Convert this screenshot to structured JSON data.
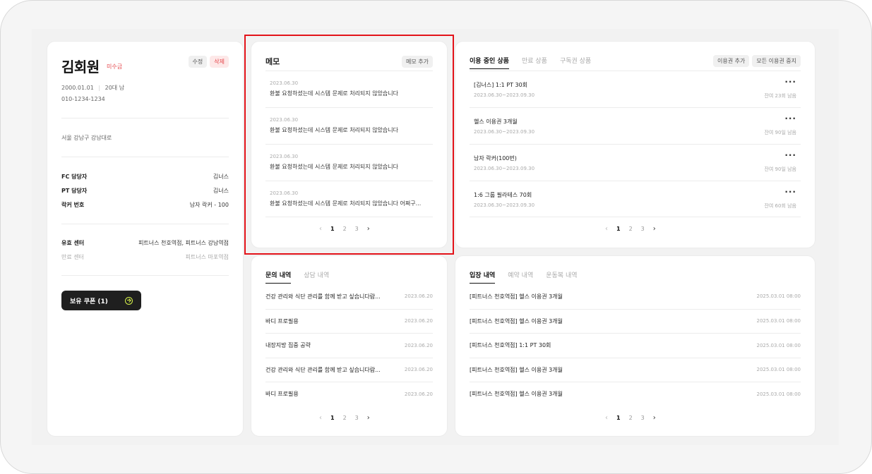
{
  "profile": {
    "name": "김회원",
    "arrears_badge": "미수금",
    "edit_label": "수정",
    "delete_label": "삭제",
    "birth": "2000.01.01",
    "age_gender": "20대 남",
    "phone": "010-1234-1234",
    "address": "서울 강남구 강남대로",
    "staff": [
      {
        "key": "FC 담당자",
        "value": "김너스"
      },
      {
        "key": "PT 담당자",
        "value": "김너스"
      },
      {
        "key": "락커 번호",
        "value": "남자 락커 - 100"
      }
    ],
    "centers": [
      {
        "key": "유효 센터",
        "value": "피트너스 천호역점, 피트너스 강남역점"
      },
      {
        "key": "만료 센터",
        "value": "피트너스 마포역점"
      }
    ],
    "coupon_label": "보유 쿠폰 (1)"
  },
  "memo": {
    "title": "메모",
    "add_label": "메모 추가",
    "items": [
      {
        "date": "2023.06.30",
        "text": "환불 요청하셨는데 시스템 문제로 처리되지 않았습니다"
      },
      {
        "date": "2023.06.30",
        "text": "환불 요청하셨는데 시스템 문제로 처리되지 않았습니다"
      },
      {
        "date": "2023.06.30",
        "text": "환불 요청하셨는데 시스템 문제로 처리되지 않았습니다"
      },
      {
        "date": "2023.06.30",
        "text": "환불 요청하셨는데 시스템 문제로 처리되지 않았습니다 어쩌구..."
      }
    ],
    "pages": [
      "1",
      "2",
      "3"
    ]
  },
  "products": {
    "tabs": [
      "이용 중인 상품",
      "만료 상품",
      "구독권 상품"
    ],
    "add_label": "이용권 추가",
    "stop_all_label": "모든 이용권 중지",
    "items": [
      {
        "name": "[김너스] 1:1 PT 30회",
        "period": "2023.06.30~2023.09.30",
        "remain": "잔여 23회 남음"
      },
      {
        "name": "헬스 이용권 3개월",
        "period": "2023.06.30~2023.09.30",
        "remain": "잔여 90일 남음"
      },
      {
        "name": "남자 락커(100번)",
        "period": "2023.06.30~2023.09.30",
        "remain": "잔여 90일 남음"
      },
      {
        "name": "1:6 그룹 필라테스 70회",
        "period": "2023.06.30~2023.09.30",
        "remain": "잔여 60회 남음"
      }
    ],
    "more_glyph": "···",
    "pages": [
      "1",
      "2",
      "3"
    ]
  },
  "inquiries": {
    "tabs": [
      "문의 내역",
      "상담 내역"
    ],
    "items": [
      {
        "title": "건강 관리와 식단 관리를 함께 받고 싶습니다람...",
        "date": "2023.06.20"
      },
      {
        "title": "바디 프로필용",
        "date": "2023.06.20"
      },
      {
        "title": "내장지방 집중 공략",
        "date": "2023.06.20"
      },
      {
        "title": "건강 관리와 식단 관리를 함께 받고 싶습니다람...",
        "date": "2023.06.20"
      },
      {
        "title": "바디 프로필용",
        "date": "2023.06.20"
      }
    ],
    "pages": [
      "1",
      "2",
      "3"
    ]
  },
  "entries": {
    "tabs": [
      "입장 내역",
      "예약 내역",
      "운동복 내역"
    ],
    "items": [
      {
        "title": "[피트너스 천호역점] 헬스 이용권 3개월",
        "date": "2025.03.01 08:00"
      },
      {
        "title": "[피트너스 천호역점] 헬스 이용권 3개월",
        "date": "2025.03.01 08:00"
      },
      {
        "title": "[피트너스 천호역점] 1:1 PT 30회",
        "date": "2025.03.01 08:00"
      },
      {
        "title": "[피트너스 천호역점] 헬스 이용권 3개월",
        "date": "2025.03.01 08:00"
      },
      {
        "title": "[피트너스 천호역점] 헬스 이용권 3개월",
        "date": "2025.03.01 08:00"
      }
    ],
    "pages": [
      "1",
      "2",
      "3"
    ]
  },
  "pager": {
    "prev": "‹",
    "next": "›"
  },
  "colors": {
    "accent_red": "#e5484d",
    "highlight": "#e3131a",
    "coupon_icon": "#d6f24a"
  }
}
